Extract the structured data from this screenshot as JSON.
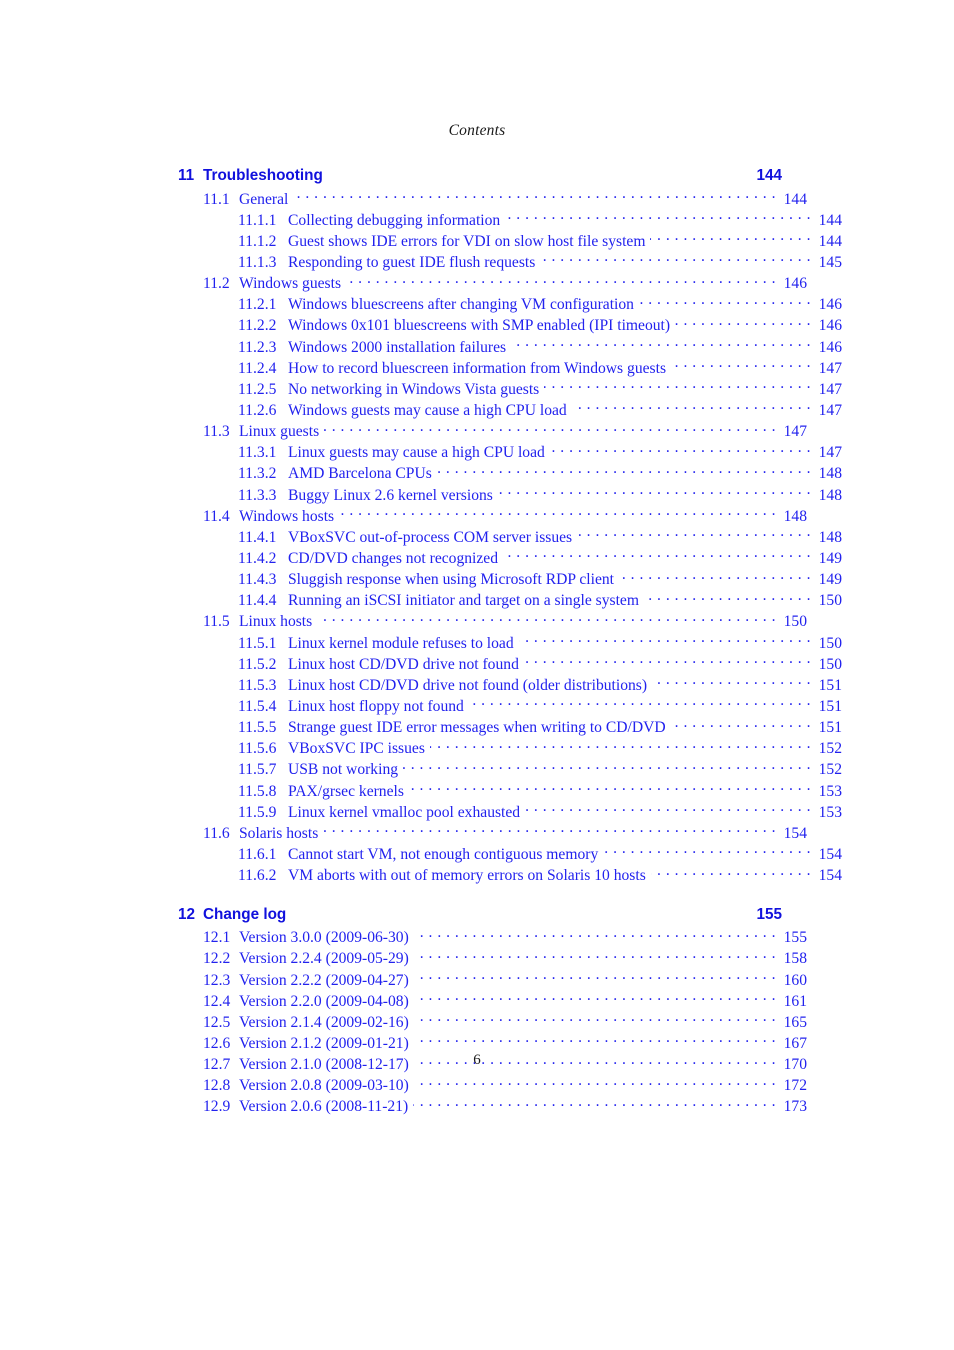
{
  "page": {
    "running_head": "Contents",
    "folio": "6",
    "link_color": "#2222ee",
    "chapter_color": "#1111dd",
    "text_color": "#1a1a1a"
  },
  "toc": {
    "entries": [
      {
        "level": "chapter",
        "num": "11",
        "label": "Troubleshooting",
        "page": "144",
        "spaced": false
      },
      {
        "level": "section",
        "num": "11.1",
        "label": "General",
        "page": "144"
      },
      {
        "level": "subsection",
        "num": "11.1.1",
        "label": "Collecting debugging information",
        "page": "144"
      },
      {
        "level": "subsection",
        "num": "11.1.2",
        "label": "Guest shows IDE errors for VDI on slow host file system",
        "page": "144"
      },
      {
        "level": "subsection",
        "num": "11.1.3",
        "label": "Responding to guest IDE flush requests",
        "page": "145"
      },
      {
        "level": "section",
        "num": "11.2",
        "label": "Windows guests",
        "page": "146"
      },
      {
        "level": "subsection",
        "num": "11.2.1",
        "label": "Windows bluescreens after changing VM configuration",
        "page": "146"
      },
      {
        "level": "subsection",
        "num": "11.2.2",
        "label": "Windows 0x101 bluescreens with SMP enabled (IPI timeout)",
        "page": "146"
      },
      {
        "level": "subsection",
        "num": "11.2.3",
        "label": "Windows 2000 installation failures",
        "page": "146"
      },
      {
        "level": "subsection",
        "num": "11.2.4",
        "label": "How to record bluescreen information from Windows guests",
        "page": "147"
      },
      {
        "level": "subsection",
        "num": "11.2.5",
        "label": "No networking in Windows Vista guests",
        "page": "147"
      },
      {
        "level": "subsection",
        "num": "11.2.6",
        "label": "Windows guests may cause a high CPU load",
        "page": "147"
      },
      {
        "level": "section",
        "num": "11.3",
        "label": "Linux guests",
        "page": "147"
      },
      {
        "level": "subsection",
        "num": "11.3.1",
        "label": "Linux guests may cause a high CPU load",
        "page": "147"
      },
      {
        "level": "subsection",
        "num": "11.3.2",
        "label": "AMD Barcelona CPUs",
        "page": "148"
      },
      {
        "level": "subsection",
        "num": "11.3.3",
        "label": "Buggy Linux 2.6 kernel versions",
        "page": "148"
      },
      {
        "level": "section",
        "num": "11.4",
        "label": "Windows hosts",
        "page": "148"
      },
      {
        "level": "subsection",
        "num": "11.4.1",
        "label": "VBoxSVC out-of-process COM server issues",
        "page": "148"
      },
      {
        "level": "subsection",
        "num": "11.4.2",
        "label": "CD/DVD changes not recognized",
        "page": "149"
      },
      {
        "level": "subsection",
        "num": "11.4.3",
        "label": "Sluggish response when using Microsoft RDP client",
        "page": "149"
      },
      {
        "level": "subsection",
        "num": "11.4.4",
        "label": "Running an iSCSI initiator and target on a single system",
        "page": "150"
      },
      {
        "level": "section",
        "num": "11.5",
        "label": "Linux hosts",
        "page": "150"
      },
      {
        "level": "subsection",
        "num": "11.5.1",
        "label": "Linux kernel module refuses to load",
        "page": "150"
      },
      {
        "level": "subsection",
        "num": "11.5.2",
        "label": "Linux host CD/DVD drive not found",
        "page": "150"
      },
      {
        "level": "subsection",
        "num": "11.5.3",
        "label": "Linux host CD/DVD drive not found (older distributions)",
        "page": "151"
      },
      {
        "level": "subsection",
        "num": "11.5.4",
        "label": "Linux host floppy not found",
        "page": "151"
      },
      {
        "level": "subsection",
        "num": "11.5.5",
        "label": "Strange guest IDE error messages when writing to CD/DVD",
        "page": "151"
      },
      {
        "level": "subsection",
        "num": "11.5.6",
        "label": "VBoxSVC IPC issues",
        "page": "152"
      },
      {
        "level": "subsection",
        "num": "11.5.7",
        "label": "USB not working",
        "page": "152"
      },
      {
        "level": "subsection",
        "num": "11.5.8",
        "label": "PAX/grsec kernels",
        "page": "153"
      },
      {
        "level": "subsection",
        "num": "11.5.9",
        "label": "Linux kernel vmalloc pool exhausted",
        "page": "153"
      },
      {
        "level": "section",
        "num": "11.6",
        "label": "Solaris hosts",
        "page": "154"
      },
      {
        "level": "subsection",
        "num": "11.6.1",
        "label": "Cannot start VM, not enough contiguous memory",
        "page": "154"
      },
      {
        "level": "subsection",
        "num": "11.6.2",
        "label": "VM aborts with out of memory errors on Solaris 10 hosts",
        "page": "154"
      },
      {
        "level": "chapter",
        "num": "12",
        "label": "Change log",
        "page": "155",
        "spaced": true
      },
      {
        "level": "section",
        "num": "12.1",
        "label": "Version 3.0.0 (2009-06-30)",
        "page": "155"
      },
      {
        "level": "section",
        "num": "12.2",
        "label": "Version 2.2.4 (2009-05-29)",
        "page": "158"
      },
      {
        "level": "section",
        "num": "12.3",
        "label": "Version 2.2.2 (2009-04-27)",
        "page": "160"
      },
      {
        "level": "section",
        "num": "12.4",
        "label": "Version 2.2.0 (2009-04-08)",
        "page": "161"
      },
      {
        "level": "section",
        "num": "12.5",
        "label": "Version 2.1.4 (2009-02-16)",
        "page": "165"
      },
      {
        "level": "section",
        "num": "12.6",
        "label": "Version 2.1.2 (2009-01-21)",
        "page": "167"
      },
      {
        "level": "section",
        "num": "12.7",
        "label": "Version 2.1.0 (2008-12-17)",
        "page": "170"
      },
      {
        "level": "section",
        "num": "12.8",
        "label": "Version 2.0.8 (2009-03-10)",
        "page": "172"
      },
      {
        "level": "section",
        "num": "12.9",
        "label": "Version 2.0.6 (2008-11-21)",
        "page": "173"
      }
    ]
  }
}
